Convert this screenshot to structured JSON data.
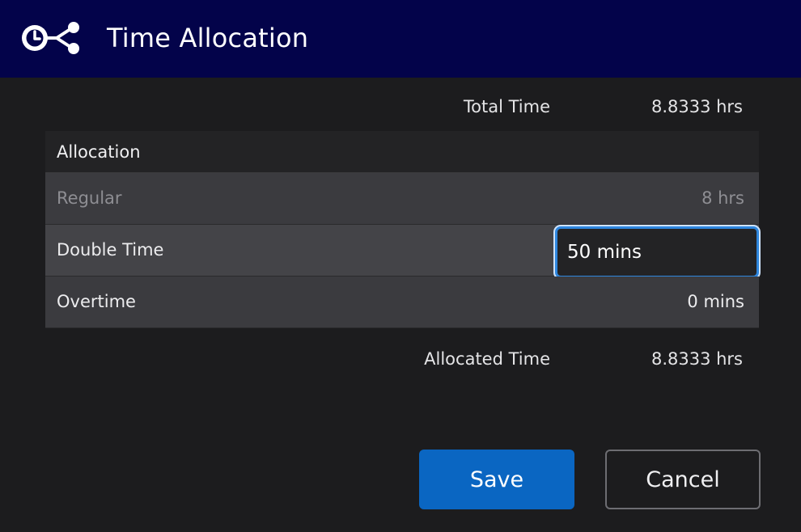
{
  "dialog": {
    "title": "Time Allocation",
    "logo_icon": "clock-share-icon"
  },
  "summary": {
    "total_label": "Total Time",
    "total_value": "8.8333 hrs",
    "allocated_label": "Allocated Time",
    "allocated_value": "8.8333 hrs"
  },
  "table": {
    "header": "Allocation",
    "rows": [
      {
        "label": "Regular",
        "value": "8 hrs",
        "state": "disabled"
      },
      {
        "label": "Double Time",
        "value": "50 mins",
        "state": "editing"
      },
      {
        "label": "Overtime",
        "value": "0 mins",
        "state": "normal"
      }
    ]
  },
  "buttons": {
    "save_label": "Save",
    "cancel_label": "Cancel"
  },
  "colors": {
    "header_bg": "#03034a",
    "accent": "#0a66c2",
    "focus_ring": "#2e86de"
  }
}
